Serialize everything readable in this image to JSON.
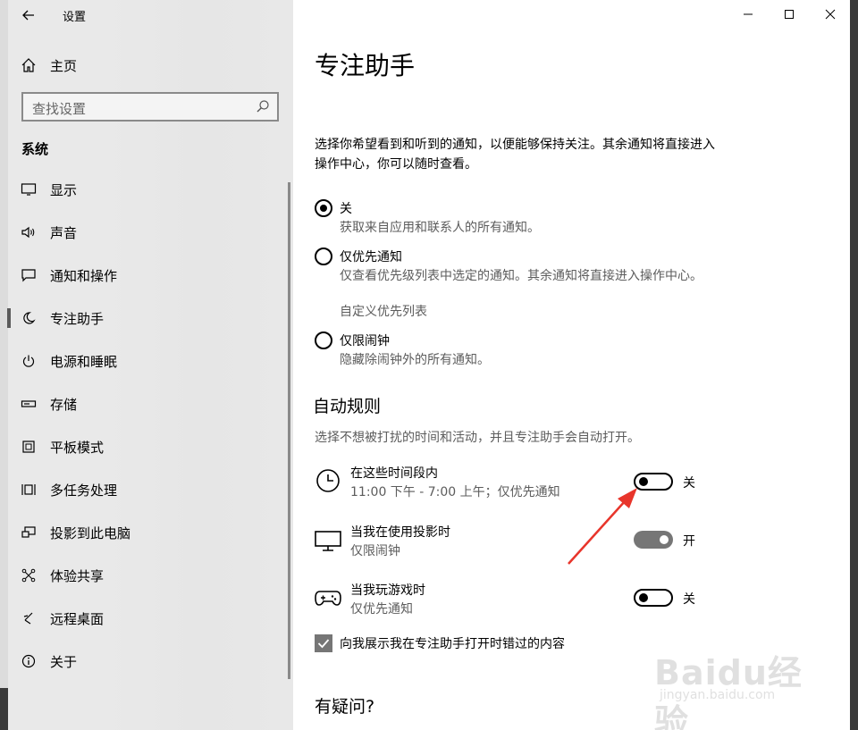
{
  "window": {
    "title": "设置",
    "back_icon": "arrow-left-icon",
    "controls": [
      "minimize-icon",
      "maximize-icon",
      "close-icon"
    ]
  },
  "sidebar": {
    "home": "主页",
    "search_placeholder": "查找设置",
    "section": "系统",
    "items": [
      {
        "label": "显示",
        "icon": "display-icon"
      },
      {
        "label": "声音",
        "icon": "speaker-icon"
      },
      {
        "label": "通知和操作",
        "icon": "notification-icon"
      },
      {
        "label": "专注助手",
        "icon": "moon-icon",
        "active": true
      },
      {
        "label": "电源和睡眠",
        "icon": "power-icon"
      },
      {
        "label": "存储",
        "icon": "storage-icon"
      },
      {
        "label": "平板模式",
        "icon": "tablet-icon"
      },
      {
        "label": "多任务处理",
        "icon": "multitask-icon"
      },
      {
        "label": "投影到此电脑",
        "icon": "project-icon"
      },
      {
        "label": "体验共享",
        "icon": "share-icon"
      },
      {
        "label": "远程桌面",
        "icon": "remote-icon"
      },
      {
        "label": "关于",
        "icon": "info-icon"
      }
    ]
  },
  "main": {
    "title": "专注助手",
    "description": "选择你希望看到和听到的通知，以便能够保持关注。其余通知将直接进入操作中心，你可以随时查看。",
    "options": [
      {
        "label": "关",
        "desc": "获取来自应用和联系人的所有通知。",
        "selected": true
      },
      {
        "label": "仅优先通知",
        "desc": "仅查看优先级列表中选定的通知。其余通知将直接进入操作中心。",
        "link": "自定义优先列表",
        "selected": false
      },
      {
        "label": "仅限闹钟",
        "desc": "隐藏除闹钟外的所有通知。",
        "selected": false
      }
    ],
    "auto_rules_title": "自动规则",
    "auto_rules_desc": "选择不想被打扰的时间和活动，并且专注助手会自动打开。",
    "rules": [
      {
        "name": "在这些时间段内",
        "sub": "11:00 下午 - 7:00 上午；仅优先通知",
        "icon": "clock-icon",
        "on": false,
        "state": "关"
      },
      {
        "name": "当我在使用投影时",
        "sub": "仅限闹钟",
        "icon": "monitor-icon",
        "on": true,
        "state": "开"
      },
      {
        "name": "当我玩游戏时",
        "sub": "仅优先通知",
        "icon": "gamepad-icon",
        "on": false,
        "state": "关"
      }
    ],
    "checkbox_label": "向我展示我在专注助手打开时错过的内容",
    "checkbox_checked": true,
    "questions_title": "有疑问?"
  },
  "annotation": {
    "color": "#e8352b"
  },
  "watermark": {
    "logo": "Baidu经验",
    "sub": "jingyan.baidu.com"
  }
}
